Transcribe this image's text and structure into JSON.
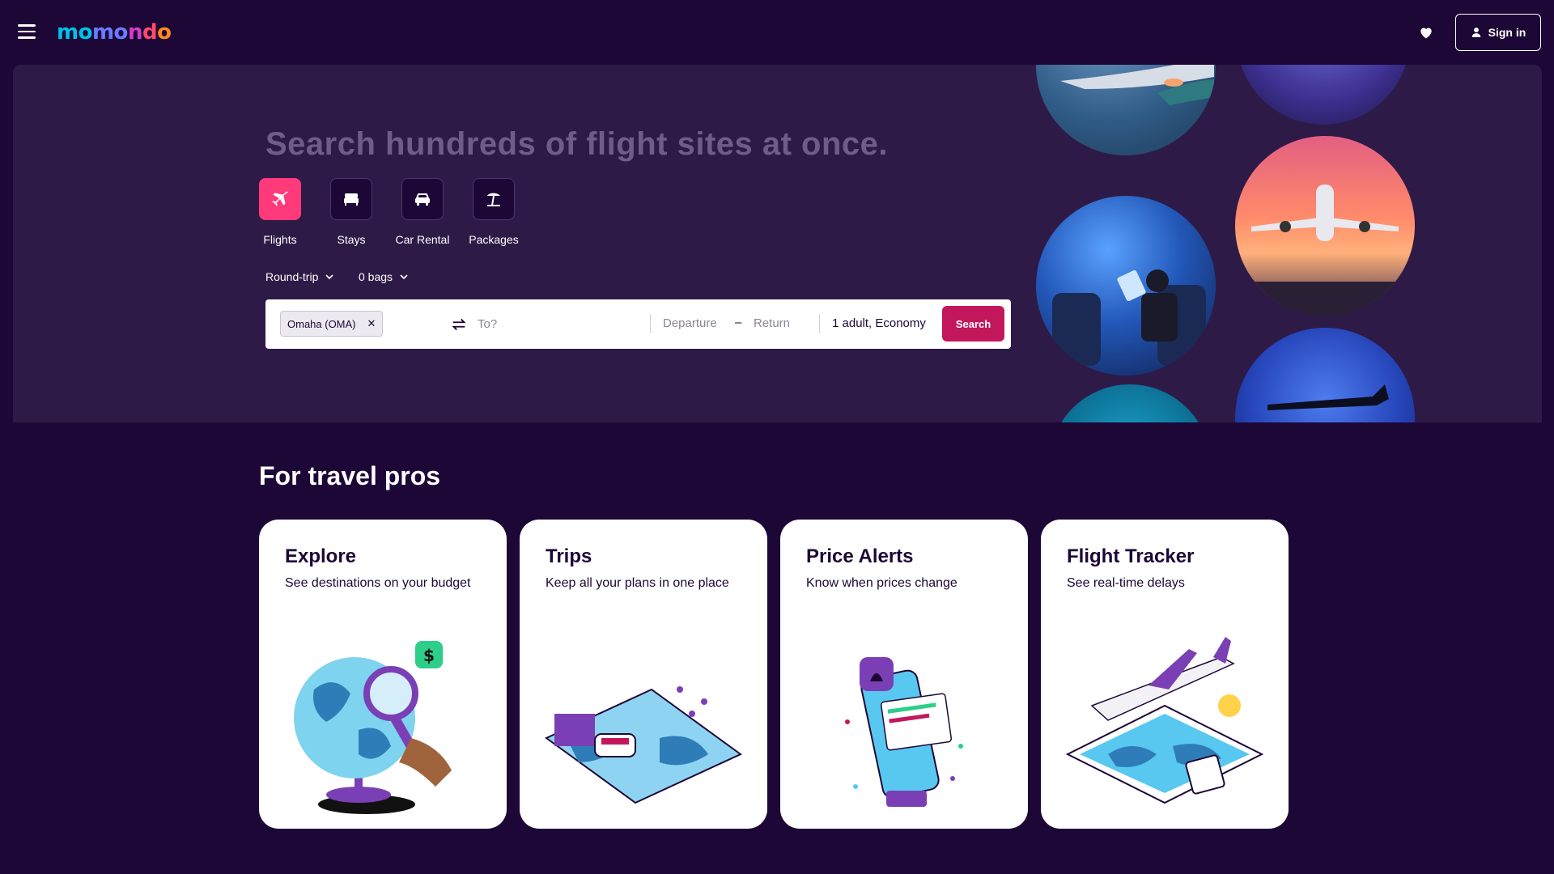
{
  "header": {
    "logo": [
      "mo",
      "mo",
      "n",
      "d",
      "o"
    ],
    "sign_in_label": "Sign in"
  },
  "hero": {
    "title": "Search hundreds of flight sites at once.",
    "verticals": [
      {
        "label": "Flights",
        "icon": "plane-icon",
        "active": true
      },
      {
        "label": "Stays",
        "icon": "bed-icon",
        "active": false
      },
      {
        "label": "Car Rental",
        "icon": "car-icon",
        "active": false
      },
      {
        "label": "Packages",
        "icon": "beach-umbrella-icon",
        "active": false
      }
    ],
    "trip_type": "Round-trip",
    "bags": "0 bags",
    "search": {
      "origin_chip": "Omaha (OMA)",
      "destination_placeholder": "To?",
      "departure_placeholder": "Departure",
      "dash": "–",
      "return_placeholder": "Return",
      "passengers": "1 adult, Economy",
      "search_label": "Search"
    }
  },
  "pros": {
    "title": "For travel pros",
    "cards": [
      {
        "title": "Explore",
        "subtitle": "See destinations on your budget"
      },
      {
        "title": "Trips",
        "subtitle": "Keep all your plans in one place"
      },
      {
        "title": "Price Alerts",
        "subtitle": "Know when prices change"
      },
      {
        "title": "Flight Tracker",
        "subtitle": "See real-time delays"
      }
    ]
  },
  "colors": {
    "background": "#1d0736",
    "hero": "#2e1a47",
    "accent_pink": "#ff3a7b",
    "search_button": "#c2185b"
  }
}
